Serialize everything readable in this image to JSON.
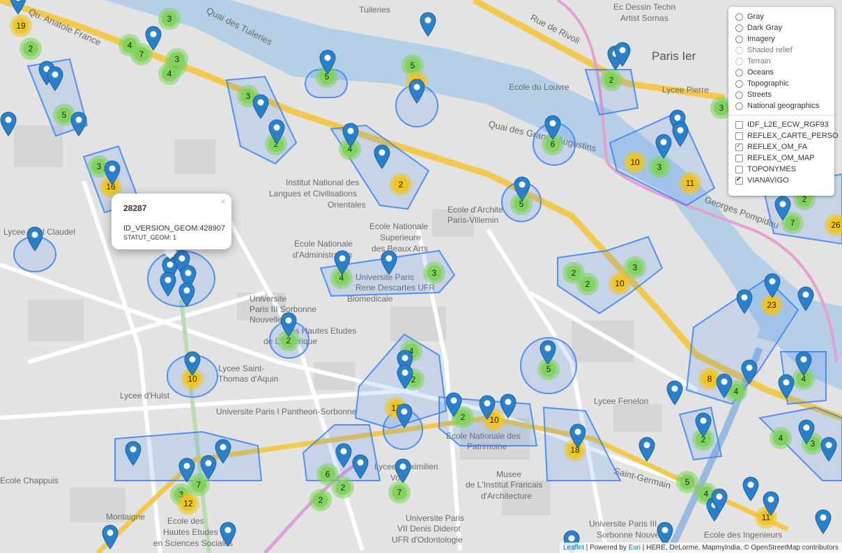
{
  "map": {
    "street_labels": [
      "Quai des Tuileries",
      "Qu. Anatole France",
      "Rue de Rivoli",
      "Quai des Grands Augustins",
      "Saint-Germain",
      "Georges Pompidou"
    ],
    "place_labels": [
      "Tuileries",
      "Ec Dessin Techn",
      "Artist Sornas",
      "Paris Ier",
      "Ecole du Louvre",
      "Lycee Pierre",
      "Institut National des",
      "Langues et Civilisations",
      "Orientales",
      "Ecole d'Archite",
      "Paris-Villemin",
      "Ecole Nationale",
      "Superieure",
      "des Beaux Arts",
      "Ecole Nationale",
      "d'Administration",
      "Lycee Paul Claudel",
      "Universite",
      "Paris III Sorbonne",
      "Nouvelle",
      "des Hautes Etudes",
      "de L'Amerique",
      "Universite Paris",
      "Rene Descartes UFR",
      "Biomedicale",
      "Lycee Saint-",
      "Thomas d'Aquin",
      "Lycee d'Hulst",
      "Universite Paris I Pantheon-Sorbonne",
      "Ecole Nationale des",
      "Patrimoine",
      "Lycee Fenelon",
      "Ecole Chappuis",
      "Montaigne",
      "Ecole des",
      "Hautes Etudes",
      "en Sciences Sociales",
      "Lycee Maximilien",
      "Vox",
      "Musee",
      "de L'Institut Francais",
      "d'Architecture",
      "Universite Paris",
      "VII Denis Diderot",
      "UFR d'Odontologie",
      "Universite Paris III",
      "Sorbonne Nouvelle",
      "Ecole des Ingenieurs"
    ],
    "clusters": [
      "19",
      "2",
      "3",
      "4",
      "7",
      "4",
      "3",
      "4",
      "5",
      "5",
      "5",
      "14",
      "3",
      "2",
      "2",
      "6",
      "4",
      "2",
      "10",
      "3",
      "11",
      "7",
      "2",
      "26",
      "3",
      "16",
      "3",
      "4",
      "3",
      "2",
      "2",
      "10",
      "3",
      "23",
      "2",
      "10",
      "5",
      "4",
      "2",
      "4",
      "8",
      "4",
      "17",
      "2",
      "10",
      "5",
      "3",
      "18",
      "6",
      "2",
      "7",
      "3",
      "12",
      "7",
      "2",
      "5",
      "4",
      "11",
      "2",
      "4"
    ],
    "colors": {
      "water": "#b5d0e6",
      "route": "#f2c94c",
      "cluster_green": "#7fd35b",
      "cluster_yellow": "#f0c419",
      "marker": "#2a81cb",
      "hull": "#3b82f6"
    }
  },
  "popup": {
    "title": "28287",
    "line1": "ID_VERSION_GEOM:428907",
    "line2": "STATUT_GEOM: 1",
    "close": "×"
  },
  "layer_control": {
    "base_layers": [
      {
        "label": "Gray",
        "enabled": true
      },
      {
        "label": "Dark Gray",
        "enabled": true
      },
      {
        "label": "Imagery",
        "enabled": true
      },
      {
        "label": "Shaded relief",
        "enabled": false
      },
      {
        "label": "Terrain",
        "enabled": false
      },
      {
        "label": "Oceans",
        "enabled": true
      },
      {
        "label": "Topographic",
        "enabled": true
      },
      {
        "label": "Streets",
        "enabled": true
      },
      {
        "label": "National geographics",
        "enabled": true
      }
    ],
    "overlays": [
      {
        "label": "IDF_L2E_ECW_RGF93",
        "checked": false
      },
      {
        "label": "REFLEX_CARTE_PERSO",
        "checked": false
      },
      {
        "label": "REFLEX_OM_FA",
        "checked": true,
        "dim": true
      },
      {
        "label": "REFLEX_OM_MAP",
        "checked": false
      },
      {
        "label": "TOPONYMES",
        "checked": false
      },
      {
        "label": "VIANAVIGO",
        "checked": true,
        "dim": false
      }
    ]
  },
  "attribution": {
    "leaflet": "Leaflet",
    "sep": " | Powered by ",
    "esri": "Esri",
    "rest": " | HERE, DeLorme, MapmyIndia, © OpenStreetMap contributors"
  }
}
